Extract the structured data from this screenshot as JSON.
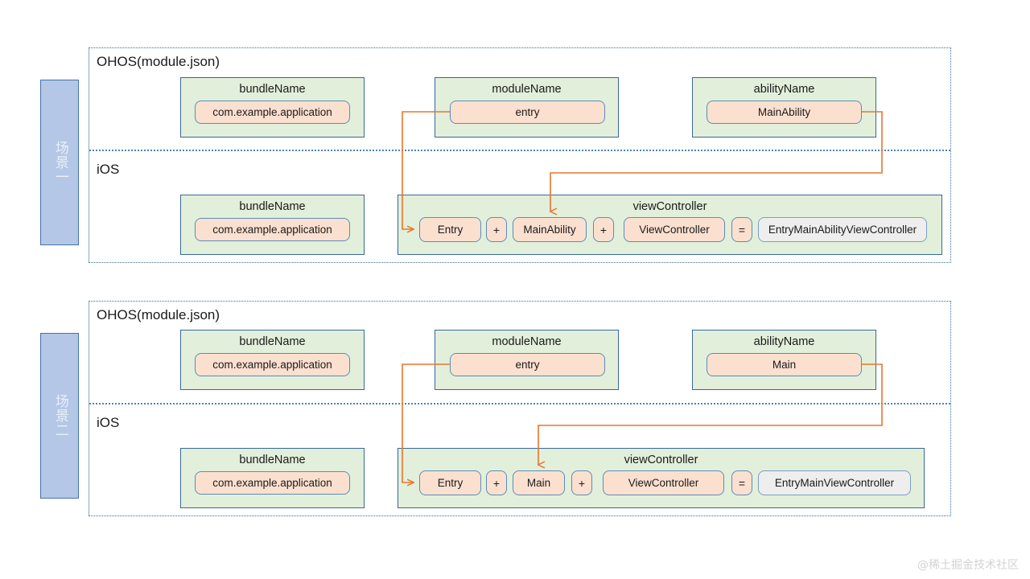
{
  "colors": {
    "group_fill": "#e2efda",
    "group_border": "#37699b",
    "chip_fill": "#fbe0d0",
    "chip_border": "#5b8db8",
    "result_fill": "#eeeeee",
    "tab_fill": "#b4c7e7",
    "tab_border": "#4472a8",
    "connector": "#e8762c",
    "section_border": "#3c6da0",
    "watermark": "#d2d2d2"
  },
  "watermark": "@稀土掘金技术社区",
  "scenarios": [
    {
      "tab_label": "场景一",
      "ohos": {
        "os_label": "OHOS(module.json)",
        "groups": [
          {
            "title": "bundleName",
            "value": "com.example.application"
          },
          {
            "title": "moduleName",
            "value": "entry"
          },
          {
            "title": "abilityName",
            "value": "MainAbility"
          }
        ]
      },
      "ios": {
        "os_label": "iOS",
        "bundle_group": {
          "title": "bundleName",
          "value": "com.example.application"
        },
        "vc_group": {
          "title": "viewController",
          "parts": [
            {
              "type": "value",
              "text": "Entry"
            },
            {
              "type": "op",
              "text": "+"
            },
            {
              "type": "value",
              "text": "MainAbility"
            },
            {
              "type": "op",
              "text": "+"
            },
            {
              "type": "value",
              "text": "ViewController"
            },
            {
              "type": "op",
              "text": "="
            },
            {
              "type": "result",
              "text": "EntryMainAbilityViewController"
            }
          ]
        }
      }
    },
    {
      "tab_label": "场景二",
      "ohos": {
        "os_label": "OHOS(module.json)",
        "groups": [
          {
            "title": "bundleName",
            "value": "com.example.application"
          },
          {
            "title": "moduleName",
            "value": "entry"
          },
          {
            "title": "abilityName",
            "value": "Main"
          }
        ]
      },
      "ios": {
        "os_label": "iOS",
        "bundle_group": {
          "title": "bundleName",
          "value": "com.example.application"
        },
        "vc_group": {
          "title": "viewController",
          "parts": [
            {
              "type": "value",
              "text": "Entry"
            },
            {
              "type": "op",
              "text": "+"
            },
            {
              "type": "value",
              "text": "Main"
            },
            {
              "type": "op",
              "text": "+"
            },
            {
              "type": "value",
              "text": "ViewController"
            },
            {
              "type": "op",
              "text": "="
            },
            {
              "type": "result",
              "text": "EntryMainViewController"
            }
          ]
        }
      }
    }
  ]
}
